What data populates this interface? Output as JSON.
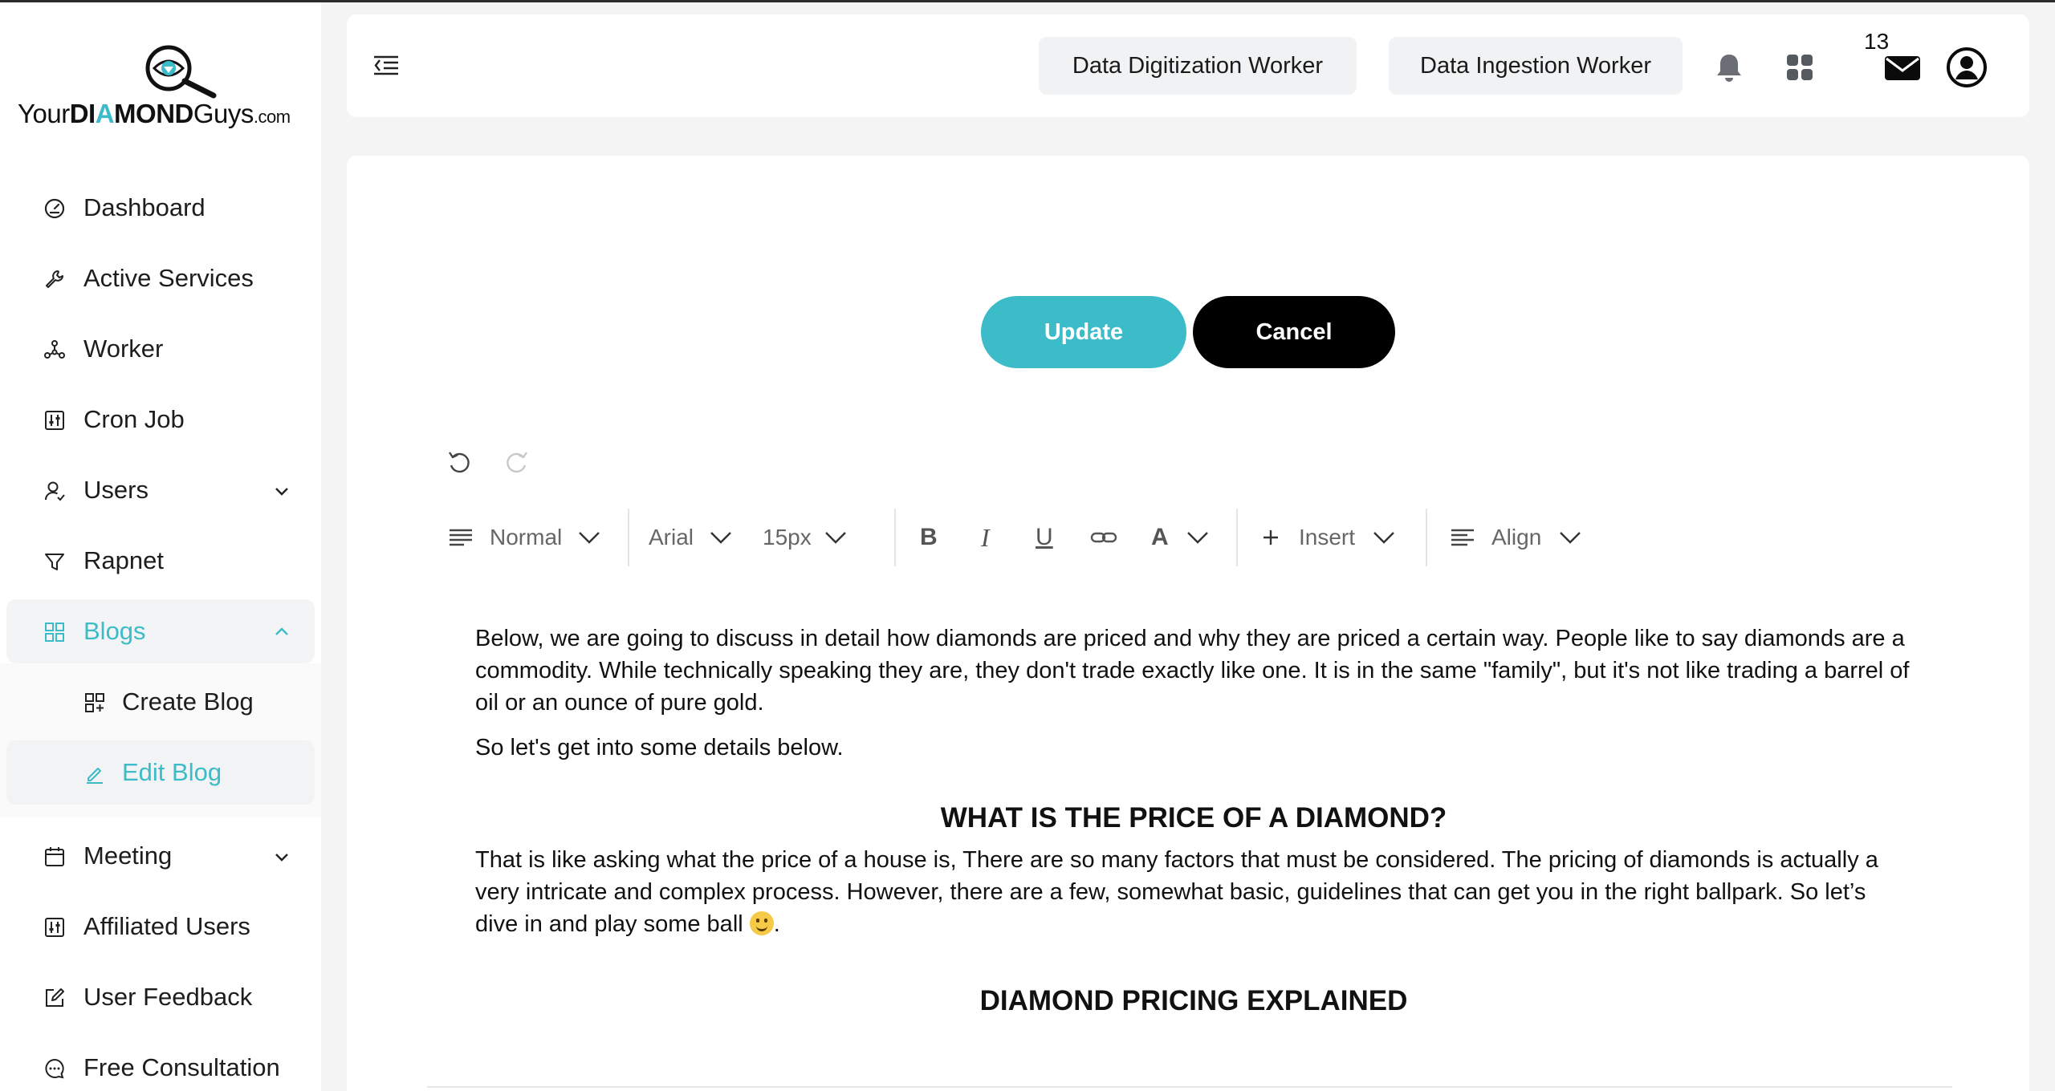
{
  "brand": {
    "logo_prefix": "Your",
    "logo_dia": "DI",
    "logo_a": "A",
    "logo_mond": "MOND",
    "logo_guys": "Guys",
    "logo_suffix": ".com",
    "accent_color": "#3bbcc8"
  },
  "sidebar": {
    "items": [
      {
        "label": "Dashboard",
        "icon": "gauge-icon"
      },
      {
        "label": "Active Services",
        "icon": "wrench-icon"
      },
      {
        "label": "Worker",
        "icon": "network-icon"
      },
      {
        "label": "Cron Job",
        "icon": "sliders-icon"
      },
      {
        "label": "Users",
        "icon": "user-icon"
      },
      {
        "label": "Rapnet",
        "icon": "filter-icon"
      },
      {
        "label": "Blogs",
        "icon": "grid-icon"
      },
      {
        "label": "Meeting",
        "icon": "calendar-icon"
      },
      {
        "label": "Affiliated Users",
        "icon": "sliders-icon"
      },
      {
        "label": "User Feedback",
        "icon": "edit-icon"
      },
      {
        "label": "Free Consultation",
        "icon": "chat-icon"
      }
    ],
    "blog_sub": [
      {
        "label": "Create Blog",
        "icon": "grid-plus-icon"
      },
      {
        "label": "Edit Blog",
        "icon": "pencil-icon"
      }
    ]
  },
  "header": {
    "worker1": "Data Digitization Worker",
    "worker2": "Data Ingestion Worker",
    "mail_count": "13"
  },
  "editor": {
    "update_label": "Update",
    "cancel_label": "Cancel",
    "toolbar": {
      "block": "Normal",
      "font": "Arial",
      "size": "15px",
      "bold": "B",
      "italic": "I",
      "underline": "U",
      "color": "A",
      "insert": "Insert",
      "align": "Align"
    },
    "content": {
      "p1": "Below, we are going to discuss in detail how diamonds are priced and why they are priced a certain way. People like to say diamonds are a commodity. While technically speaking they are, they don't trade exactly like one. It is in the same \"family\", but it's not like trading a barrel of oil or an ounce of pure gold.",
      "p2": "So let's get into some details below.",
      "h1": "WHAT IS THE PRICE OF A DIAMOND?",
      "p3": "That is like asking what the price of a house is, There are so many factors that must be considered. The pricing of diamonds is actually a very intricate and complex process. However, there are a few, somewhat basic, guidelines that can get you in the right ballpark. So let’s dive in and play some ball",
      "p3_end": ".",
      "h2": "DIAMOND PRICING EXPLAINED"
    }
  }
}
